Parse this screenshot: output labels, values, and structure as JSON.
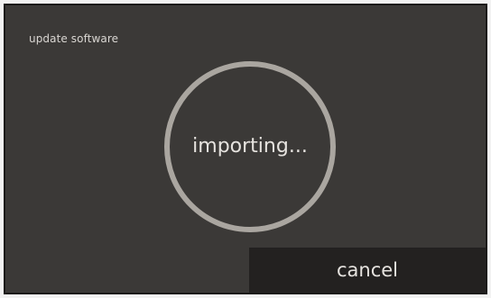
{
  "window": {
    "title": "update software"
  },
  "progress": {
    "status_text": "importing..."
  },
  "actions": {
    "cancel_label": "cancel"
  },
  "colors": {
    "background": "#3b3937",
    "ring": "#aaa6a0",
    "button": "#232120",
    "text": "#e6e3df"
  },
  "icons": [
    "progress-ring-icon"
  ]
}
